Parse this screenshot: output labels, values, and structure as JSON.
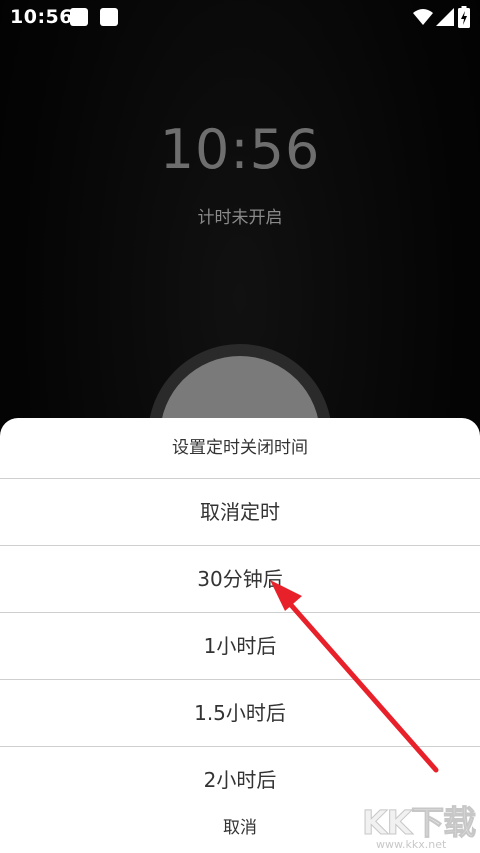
{
  "status_bar": {
    "time": "10:56"
  },
  "clock": {
    "time": "10:56",
    "status": "计时未开启"
  },
  "sheet": {
    "title": "设置定时关闭时间",
    "options": [
      {
        "label": "取消定时"
      },
      {
        "label": "30分钟后"
      },
      {
        "label": "1小时后"
      },
      {
        "label": "1.5小时后"
      },
      {
        "label": "2小时后"
      }
    ],
    "cancel_label": "取消"
  },
  "watermark": {
    "logo": "KK下载",
    "url": "www.kkx.net"
  },
  "colors": {
    "arrow": "#e8202a",
    "sheet_bg": "#ffffff",
    "clock_text": "#6e6e6e"
  }
}
